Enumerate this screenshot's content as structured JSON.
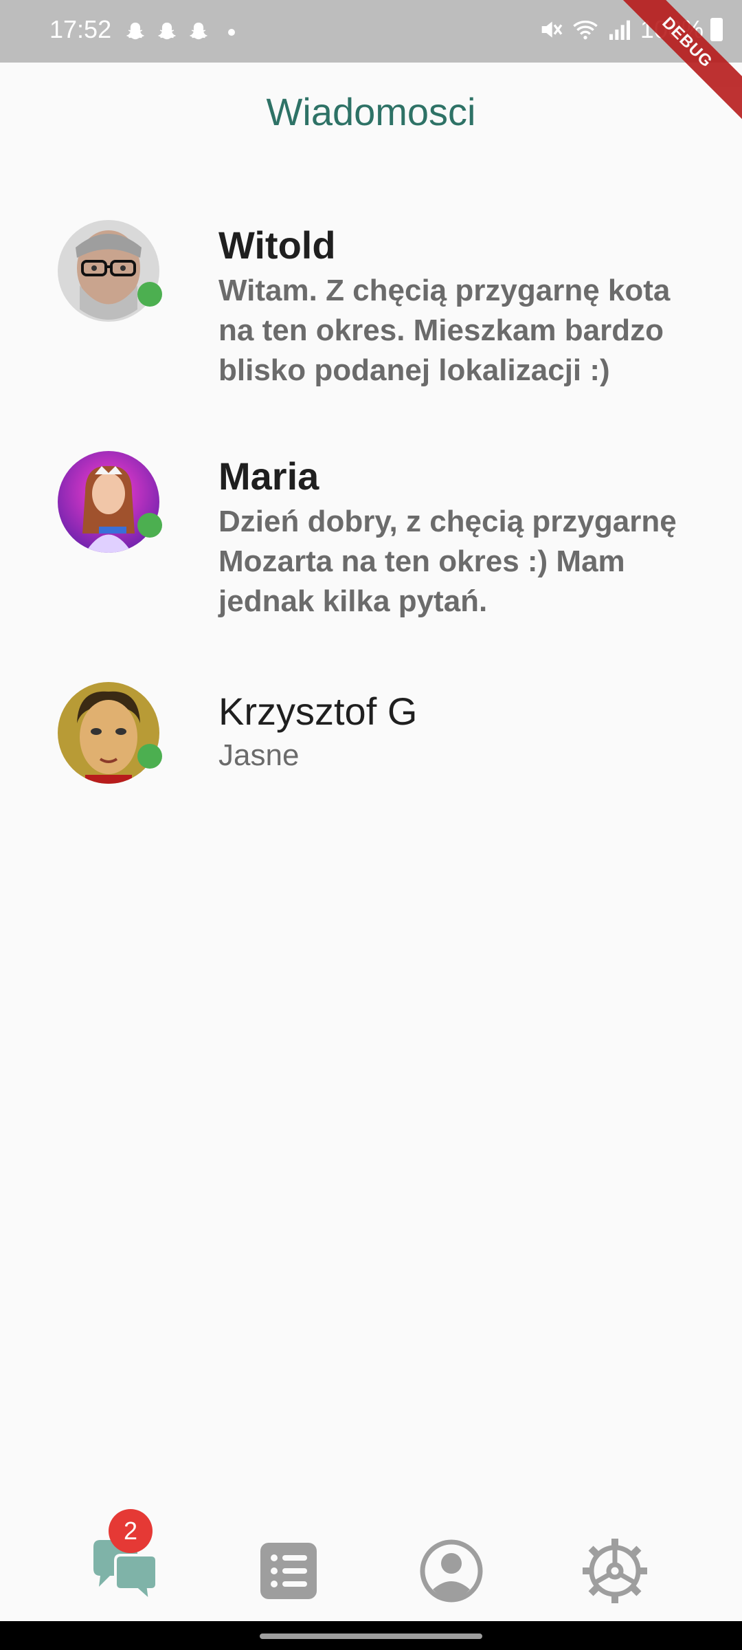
{
  "status_bar": {
    "time": "17:52",
    "battery": "100%",
    "notification_icons": [
      "snapchat-icon",
      "snapchat-icon",
      "snapchat-icon"
    ]
  },
  "debug_banner": "DEBUG",
  "header": {
    "title": "Wiadomosci"
  },
  "conversations": [
    {
      "name": "Witold",
      "message": "Witam. Z chęcią przygarnę kota na ten okres. Mieszkam bardzo blisko podanej lokalizacji :)",
      "unread": true,
      "online": true
    },
    {
      "name": "Maria",
      "message": "Dzień dobry, z chęcią przygarnę Mozarta na ten okres :) Mam jednak kilka pytań.",
      "unread": true,
      "online": true
    },
    {
      "name": "Krzysztof G",
      "message": "Jasne",
      "unread": false,
      "online": true
    }
  ],
  "bottom_nav": {
    "badge_count": "2",
    "items": [
      "chat-icon",
      "list-icon",
      "profile-icon",
      "settings-icon"
    ]
  },
  "colors": {
    "accent": "#2e7266",
    "online": "#4caf50",
    "badge": "#e53935",
    "nav_active": "#7fb3a8",
    "nav_inactive": "#9e9e9e"
  }
}
